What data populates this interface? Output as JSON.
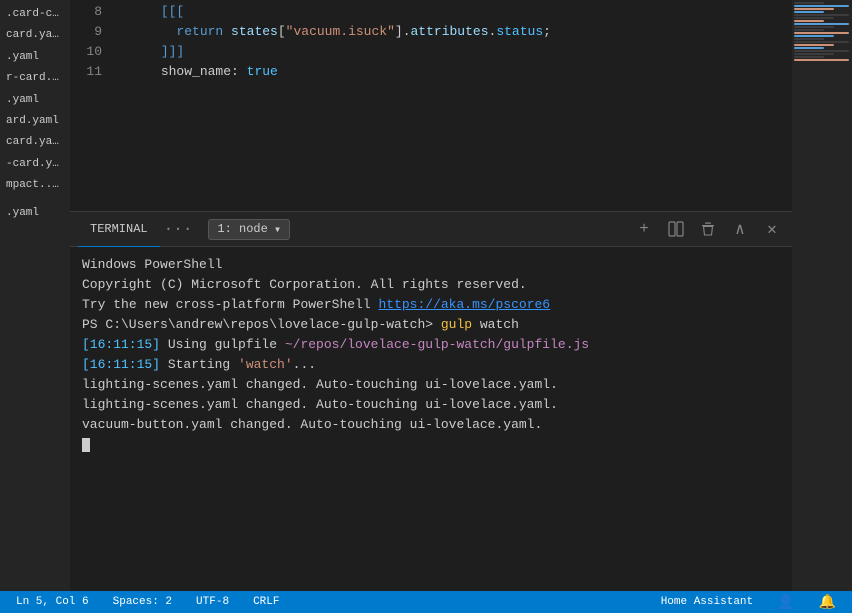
{
  "sidebar": {
    "items": [
      {
        "label": ".card-c..."
      },
      {
        "label": "card.ya..."
      },
      {
        "label": ".yaml"
      },
      {
        "label": "r-card...."
      },
      {
        "label": ".yaml"
      },
      {
        "label": "ard.yaml"
      },
      {
        "label": "card.ya..."
      },
      {
        "label": "-card.y..."
      },
      {
        "label": "mpact...."
      },
      {
        "label": ""
      },
      {
        "label": ".yaml"
      }
    ]
  },
  "code": {
    "lines": [
      {
        "num": "8",
        "content": "      [[["
      },
      {
        "num": "9",
        "content": "        return states[\"vacuum.isuck\"].attributes.status;"
      },
      {
        "num": "10",
        "content": "      ]]]"
      },
      {
        "num": "11",
        "content": "      show_name: true"
      }
    ]
  },
  "terminal": {
    "tab_label": "TERMINAL",
    "ellipsis": "···",
    "dropdown_label": "1: node",
    "add_icon": "+",
    "split_icon": "⧉",
    "delete_icon": "🗑",
    "up_icon": "∧",
    "close_icon": "✕",
    "lines": [
      {
        "text": "Windows PowerShell"
      },
      {
        "text": "Copyright (C) Microsoft Corporation. All rights reserved."
      },
      {
        "text": ""
      },
      {
        "text": "Try the new cross-platform PowerShell https://aka.ms/pscore6"
      },
      {
        "text": ""
      },
      {
        "text": "PS C:\\Users\\andrew\\repos\\lovelace-gulp-watch> gulp watch",
        "has_gulp": true
      },
      {
        "text": "[16:11:15] Using gulpfile ~/repos/lovelace-gulp-watch/gulpfile.js",
        "has_gulpfile": true
      },
      {
        "text": "[16:11:15] Starting 'watch'...",
        "has_starting": true
      },
      {
        "text": "lighting-scenes.yaml changed. Auto-touching ui-lovelace.yaml."
      },
      {
        "text": "lighting-scenes.yaml changed. Auto-touching ui-lovelace.yaml."
      },
      {
        "text": "vacuum-button.yaml changed. Auto-touching ui-lovelace.yaml."
      }
    ]
  },
  "statusbar": {
    "ln": "Ln 5, Col 6",
    "spaces": "Spaces: 2",
    "encoding": "UTF-8",
    "eol": "CRLF",
    "project": "Home Assistant",
    "bell_icon": "🔔",
    "user_icon": "👤"
  }
}
